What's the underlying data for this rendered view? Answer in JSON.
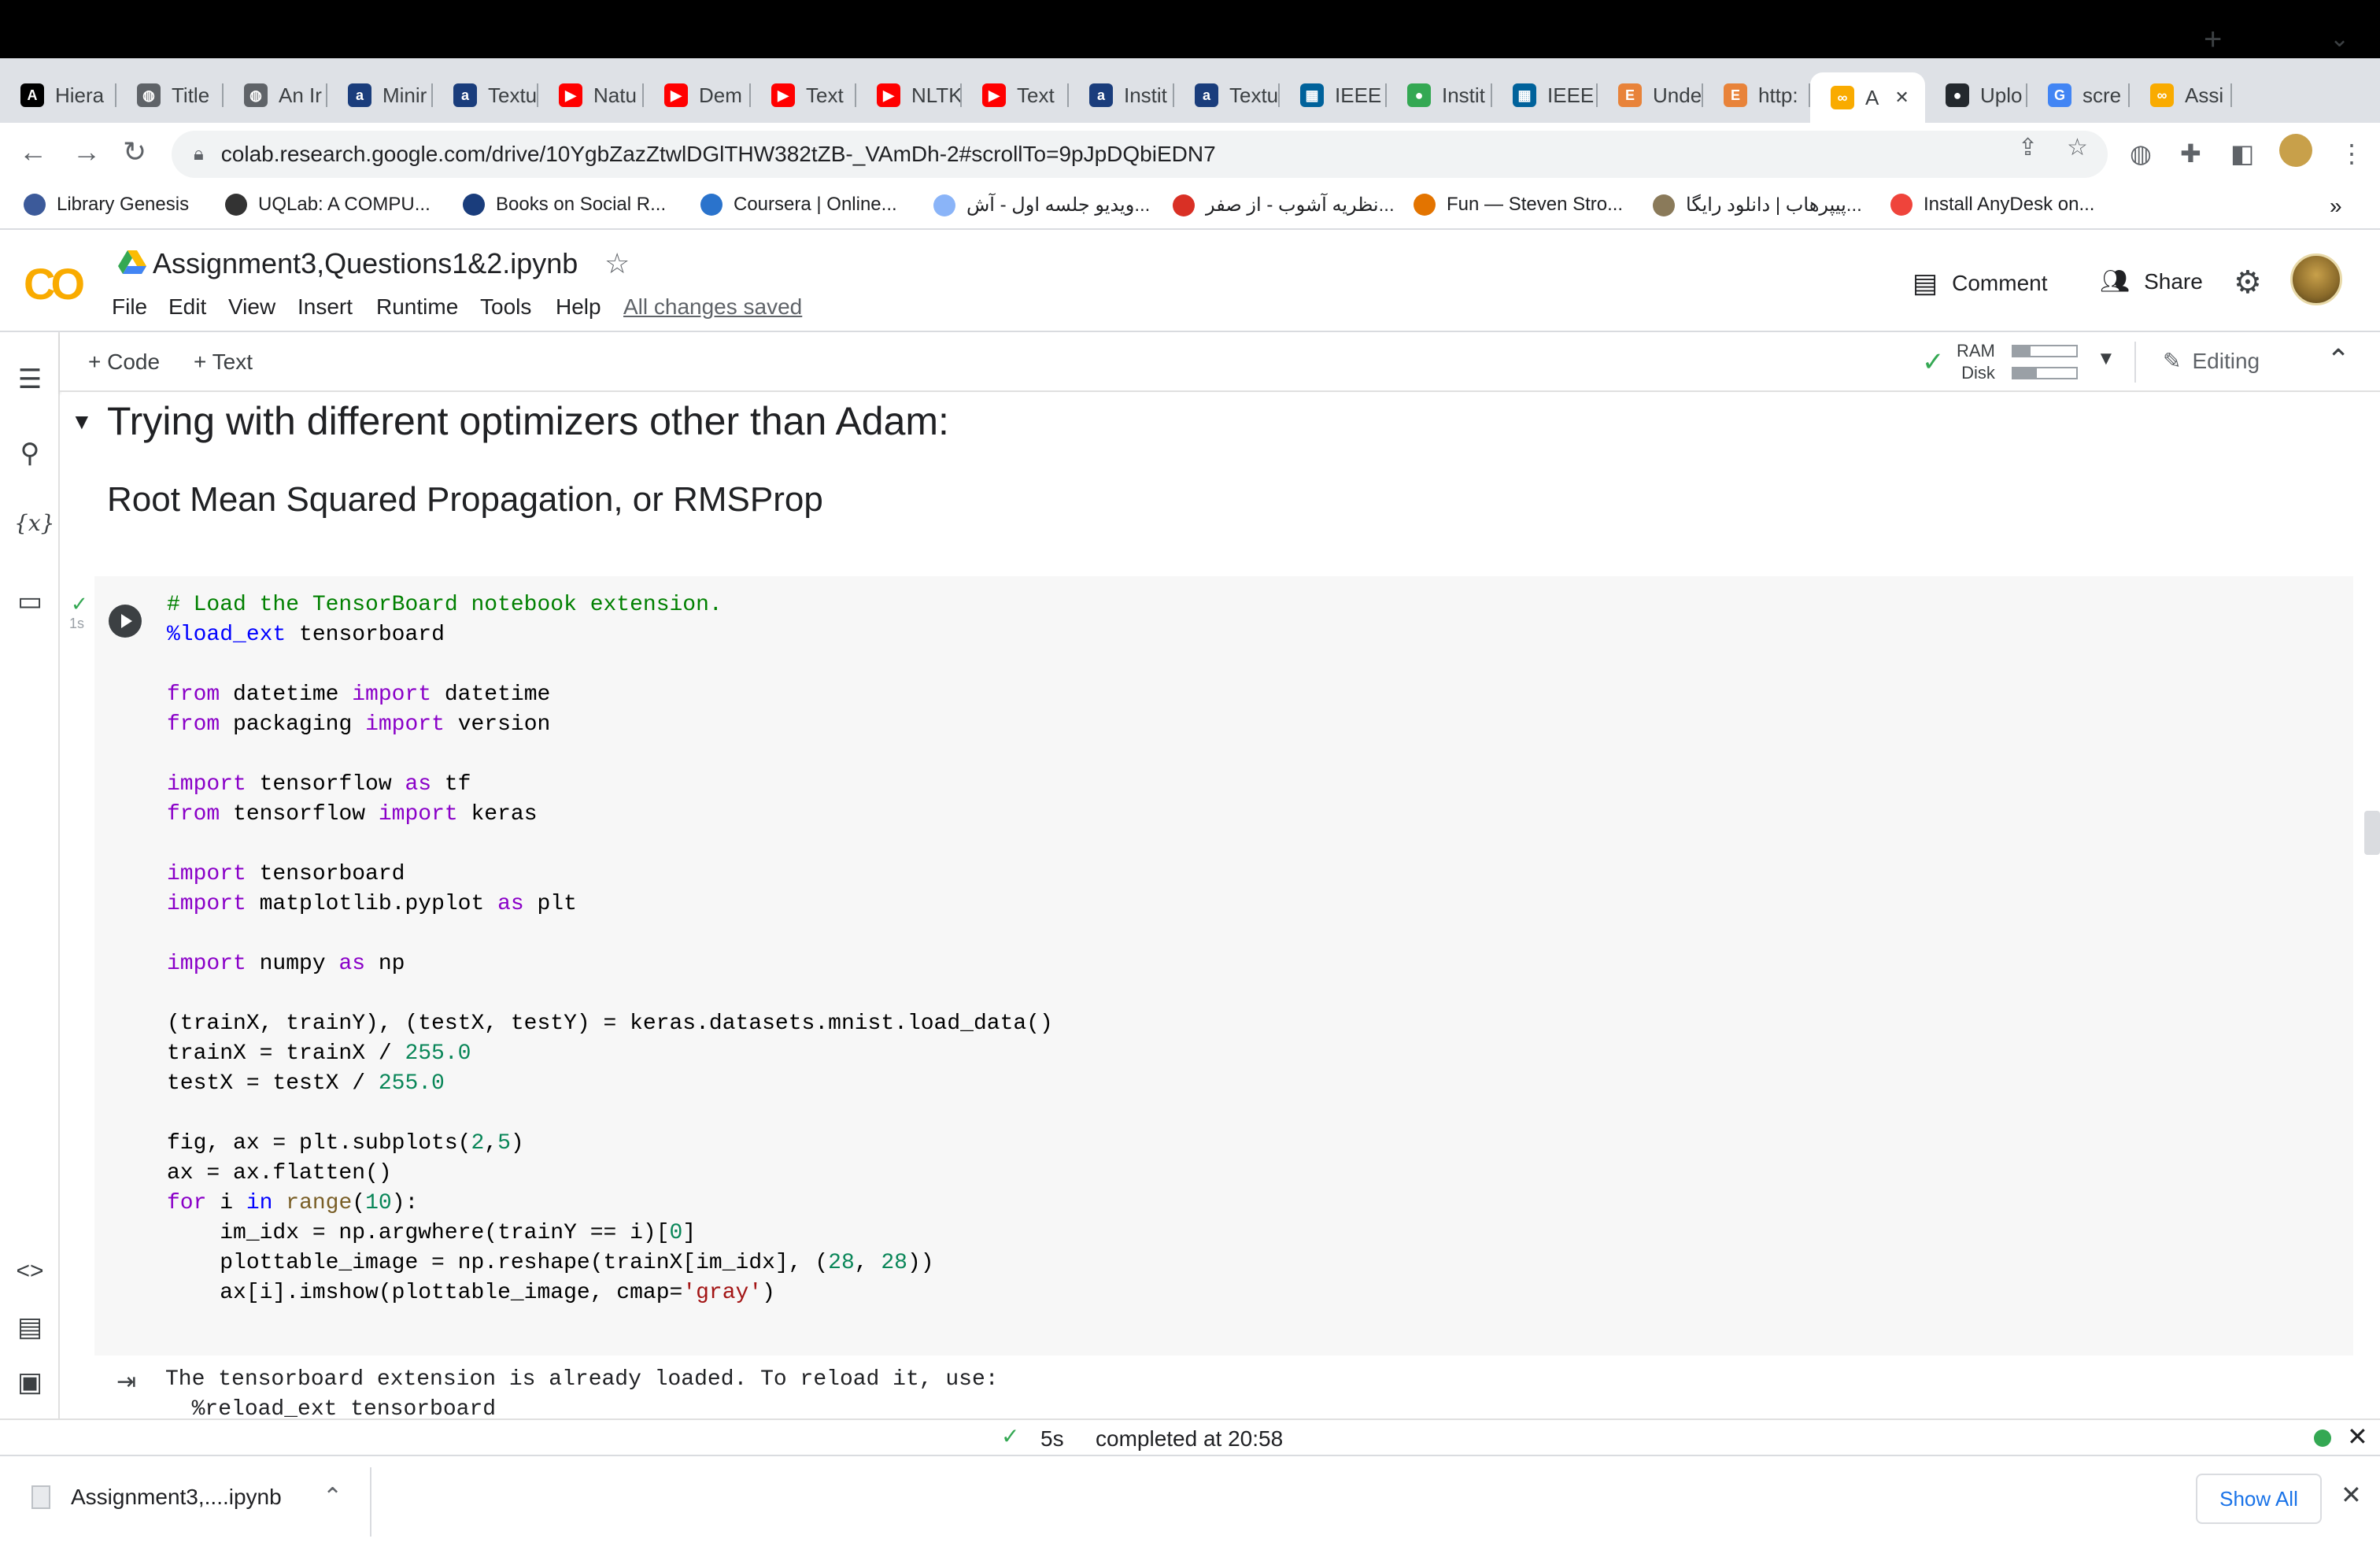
{
  "browser": {
    "tabs": [
      {
        "label": "Hiera",
        "icon": "asu-icon",
        "color": "#000000"
      },
      {
        "label": "Title",
        "icon": "globe-icon",
        "color": "#5f6368"
      },
      {
        "label": "An Ir",
        "icon": "globe-icon",
        "color": "#5f6368"
      },
      {
        "label": "Minir",
        "icon": "arc-icon",
        "color": "#1a3d7c"
      },
      {
        "label": "Textu",
        "icon": "arc-icon",
        "color": "#1a3d7c"
      },
      {
        "label": "Natu",
        "icon": "youtube-icon",
        "color": "#ff0000"
      },
      {
        "label": "Dem",
        "icon": "youtube-icon",
        "color": "#ff0000"
      },
      {
        "label": "Text",
        "icon": "youtube-icon",
        "color": "#ff0000"
      },
      {
        "label": "NLTK",
        "icon": "youtube-icon",
        "color": "#ff0000"
      },
      {
        "label": "Text",
        "icon": "youtube-icon",
        "color": "#ff0000"
      },
      {
        "label": "Instit",
        "icon": "arc-icon",
        "color": "#1a3d7c"
      },
      {
        "label": "Textu",
        "icon": "arc-icon",
        "color": "#1a3d7c"
      },
      {
        "label": "IEEE",
        "icon": "ieee-icon",
        "color": "#00629b"
      },
      {
        "label": "Instit",
        "icon": "chrome-icon",
        "color": "#34a853"
      },
      {
        "label": "IEEE",
        "icon": "ieee-icon",
        "color": "#00629b"
      },
      {
        "label": "Unde",
        "icon": "e-icon",
        "color": "#e8833a"
      },
      {
        "label": "http:",
        "icon": "e-icon",
        "color": "#e8833a"
      },
      {
        "label": "A",
        "icon": "colab-icon",
        "color": "#f9ab00",
        "active": true
      },
      {
        "label": "Uplo",
        "icon": "github-icon",
        "color": "#24292e"
      },
      {
        "label": "scre",
        "icon": "google-icon",
        "color": "#4285f4"
      },
      {
        "label": "Assi",
        "icon": "colab-icon",
        "color": "#f9ab00"
      }
    ],
    "url": "colab.research.google.com/drive/10YgbZazZtwlDGlTHW382tZB-_VAmDh-2#scrollTo=9pJpDQbiEDN7",
    "bookmarks": [
      {
        "label": "Library Genesis",
        "color": "#3c5a9a"
      },
      {
        "label": "UQLab: A COMPU...",
        "color": "#333333"
      },
      {
        "label": "Books on Social R...",
        "color": "#1a3d7c"
      },
      {
        "label": "Coursera | Online...",
        "color": "#2a73cc"
      },
      {
        "label": "ویدیو جلسه اول - آش...",
        "color": "#8ab4f8"
      },
      {
        "label": "نظریه آشوب - از صفر...",
        "color": "#d93025"
      },
      {
        "label": "Fun — Steven Stro...",
        "color": "#e37400"
      },
      {
        "label": "پیپرهاب | دانلود رایگا...",
        "color": "#8a7a5a"
      },
      {
        "label": "Install AnyDesk on...",
        "color": "#ef443b"
      }
    ],
    "more_bookmarks": "»"
  },
  "colab": {
    "title": "Assignment3,Questions1&2.ipynb",
    "menu": [
      "File",
      "Edit",
      "View",
      "Insert",
      "Runtime",
      "Tools",
      "Help"
    ],
    "saved_status": "All changes saved",
    "comment_label": "Comment",
    "share_label": "Share",
    "toolbar": {
      "add_code": "+ Code",
      "add_text": "+ Text",
      "ram_label": "RAM",
      "disk_label": "Disk",
      "ram_usage": 0.28,
      "disk_usage": 0.38,
      "mode_label": "Editing"
    },
    "section_title": "Trying with different optimizers other than Adam:",
    "subsection_title": "Root Mean Squared Propagation, or RMSProp",
    "cell": {
      "exec_time": "1s",
      "output_lines": [
        "The tensorboard extension is already loaded. To reload it, use:",
        "  %reload_ext tensorboard"
      ]
    },
    "status": {
      "duration": "5s",
      "completed": "completed at 20:58"
    }
  },
  "downloads": {
    "file": "Assignment3,....ipynb",
    "show_all": "Show All"
  }
}
